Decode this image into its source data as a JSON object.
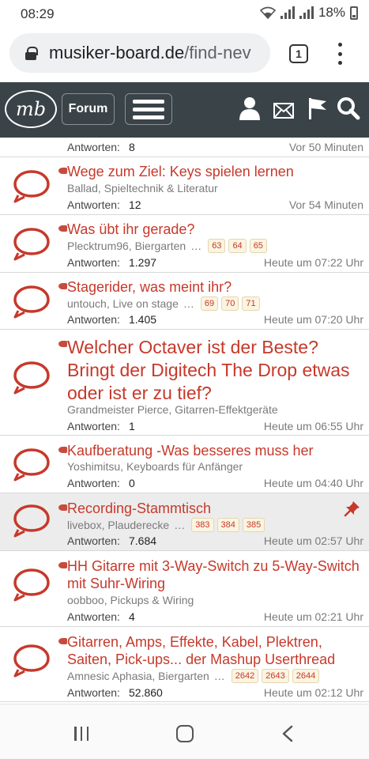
{
  "status_bar": {
    "time": "08:29",
    "battery": "18%"
  },
  "browser": {
    "url_host": "musiker-board.de",
    "url_rest": "/find-nev",
    "tab_count": "1"
  },
  "site_header": {
    "logo_text": "mb",
    "forum_label": "Forum"
  },
  "threads": [
    {
      "title": "",
      "meta": "",
      "replies_label": "Antworten:",
      "replies": "8",
      "time": "Vor 50 Minuten",
      "pages": [],
      "sticky": false
    },
    {
      "title": "Wege zum Ziel: Keys spielen lernen",
      "meta": "Ballad, Spieltechnik & Literatur",
      "replies_label": "Antworten:",
      "replies": "12",
      "time": "Vor 54 Minuten",
      "pages": [],
      "sticky": false
    },
    {
      "title": "Was übt ihr gerade?",
      "meta": "Plecktrum96, Biergarten",
      "replies_label": "Antworten:",
      "replies": "1.297",
      "time": "Heute um 07:22 Uhr",
      "pages": [
        "63",
        "64",
        "65"
      ],
      "sticky": false
    },
    {
      "title": "Stagerider, was meint ihr?",
      "meta": "untouch, Live on stage",
      "replies_label": "Antworten:",
      "replies": "1.405",
      "time": "Heute um 07:20 Uhr",
      "pages": [
        "69",
        "70",
        "71"
      ],
      "sticky": false
    },
    {
      "title": "Welcher Octaver ist der Beste? Bringt der Digitech The Drop etwas oder ist er zu tief?",
      "meta": "Grandmeister Pierce, Gitarren-Effektgeräte",
      "replies_label": "Antworten:",
      "replies": "1",
      "time": "Heute um 06:55 Uhr",
      "pages": [],
      "sticky": false
    },
    {
      "title": "Kaufberatung -Was besseres muss her",
      "meta": "Yoshimitsu, Keyboards für Anfänger",
      "replies_label": "Antworten:",
      "replies": "0",
      "time": "Heute um 04:40 Uhr",
      "pages": [],
      "sticky": false
    },
    {
      "title": "Recording-Stammtisch",
      "meta": "livebox, Plauderecke",
      "replies_label": "Antworten:",
      "replies": "7.684",
      "time": "Heute um 02:57 Uhr",
      "pages": [
        "383",
        "384",
        "385"
      ],
      "sticky": true
    },
    {
      "title": "HH Gitarre mit 3-Way-Switch zu 5-Way-Switch mit Suhr-Wiring",
      "meta": "oobboo, Pickups & Wiring",
      "replies_label": "Antworten:",
      "replies": "4",
      "time": "Heute um 02:21 Uhr",
      "pages": [],
      "sticky": false
    },
    {
      "title": "Gitarren, Amps, Effekte, Kabel, Plektren, Saiten, Pick-ups... der Mashup Userthread",
      "meta": "Amnesic Aphasia, Biergarten",
      "replies_label": "Antworten:",
      "replies": "52.860",
      "time": "Heute um 02:12 Uhr",
      "pages": [
        "2642",
        "2643",
        "2644"
      ],
      "sticky": false
    }
  ],
  "icons": {
    "thread": "speech-bubble-icon",
    "pinned": "pin-icon",
    "header": [
      "user-icon",
      "mail-icon",
      "flag-icon",
      "search-icon"
    ],
    "nav": [
      "recent-apps-icon",
      "home-icon",
      "back-icon"
    ]
  },
  "colors": {
    "accent": "#c6392b",
    "header_bg": "#3a4348",
    "page_badge_bg": "#fbf4e0"
  }
}
